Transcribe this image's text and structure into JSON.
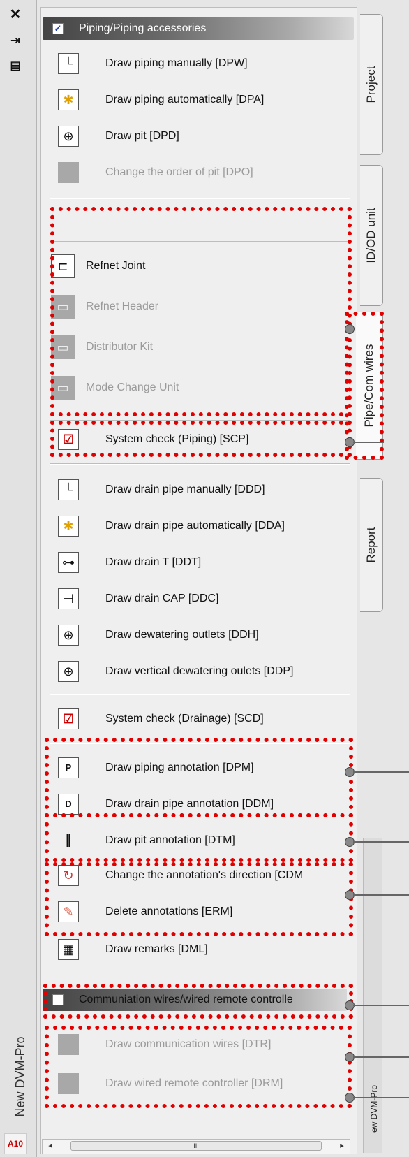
{
  "app": {
    "vertical_title": "New DVM-Pro",
    "logo_text": "A10"
  },
  "window_controls": {
    "close": "✕",
    "pin": "⇥",
    "props": "▤"
  },
  "header": {
    "title": "Piping/Piping accessories",
    "checked": true
  },
  "piping_items": [
    {
      "label": "Draw piping manually [DPW]",
      "icon": "pipe-manual-icon",
      "glyph": "└",
      "enabled": true
    },
    {
      "label": "Draw piping automatically [DPA]",
      "icon": "pipe-auto-icon",
      "glyph": "✱",
      "enabled": true
    },
    {
      "label": "Draw pit [DPD]",
      "icon": "pit-icon",
      "glyph": "⊕",
      "enabled": true
    },
    {
      "label": "Change the order of pit [DPO]",
      "icon": "pit-order-icon",
      "glyph": "",
      "enabled": false
    }
  ],
  "refnet_items": [
    {
      "label": "Refnet Joint",
      "icon": "refnet-joint-icon",
      "glyph": "⊏",
      "enabled": true
    },
    {
      "label": "Refnet Header",
      "icon": "refnet-header-icon",
      "glyph": "▭",
      "enabled": false
    },
    {
      "label": "Distributor Kit",
      "icon": "distributor-kit-icon",
      "glyph": "▭",
      "enabled": false
    },
    {
      "label": "Mode Change Unit",
      "icon": "mode-change-unit-icon",
      "glyph": "▭",
      "enabled": false
    }
  ],
  "system_check_piping": {
    "label": "System check (Piping) [SCP]",
    "glyph": "☑"
  },
  "drain_items": [
    {
      "label": "Draw drain pipe manually [DDD]",
      "icon": "drain-manual-icon",
      "glyph": "└"
    },
    {
      "label": "Draw drain pipe automatically [DDA]",
      "icon": "drain-auto-icon",
      "glyph": "✱"
    },
    {
      "label": "Draw drain T [DDT]",
      "icon": "drain-t-icon",
      "glyph": "⊶"
    },
    {
      "label": "Draw drain CAP [DDC]",
      "icon": "drain-cap-icon",
      "glyph": "⊣"
    },
    {
      "label": "Draw dewatering outlets [DDH]",
      "icon": "dewatering-outlet-icon",
      "glyph": "⊕"
    },
    {
      "label": "Draw vertical dewatering oulets [DDP]",
      "icon": "vertical-dewatering-icon",
      "glyph": "⊕"
    }
  ],
  "system_check_drainage": {
    "label": "System check (Drainage) [SCD]",
    "glyph": "☑"
  },
  "annotation_items": [
    {
      "label": "Draw piping annotation [DPM]",
      "icon": "piping-annotation-icon",
      "glyph": "P"
    },
    {
      "label": "Draw drain pipe annotation [DDM]",
      "icon": "drain-annotation-icon",
      "glyph": "D"
    },
    {
      "label": "Draw pit annotation [DTM]",
      "icon": "pit-annotation-icon",
      "glyph": "∥"
    },
    {
      "label": "Change the annotation's direction [CDM",
      "icon": "annotation-direction-icon",
      "glyph": "↻"
    },
    {
      "label": "Delete annotations [ERM]",
      "icon": "delete-annotation-icon",
      "glyph": "✎"
    },
    {
      "label": "Draw remarks [DML]",
      "icon": "remarks-icon",
      "glyph": "▦"
    }
  ],
  "comm_header": {
    "title": "Communiation wires/wired remote controlle",
    "checked": false
  },
  "comm_items": [
    {
      "label": "Draw communication wires [DTR]",
      "icon": "comm-wires-icon"
    },
    {
      "label": "Draw wired remote controller [DRM]",
      "icon": "remote-controller-icon"
    }
  ],
  "tabs": [
    {
      "label": "Project"
    },
    {
      "label": "ID/OD unit"
    },
    {
      "label": "Pipe/Com wires"
    },
    {
      "label": "Report"
    }
  ],
  "right_strip_label": "ew DVM-Pro",
  "scrollbar": {
    "left": "◂",
    "right": "▸",
    "thumb": "III"
  },
  "colors": {
    "highlight": "#e00000",
    "header_dark": "#444444",
    "disabled_text": "#9a9a9a"
  }
}
